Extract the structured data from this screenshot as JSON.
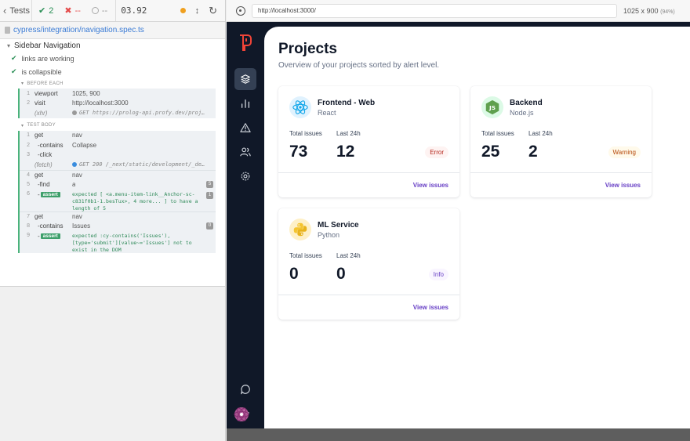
{
  "runner": {
    "back_label": "Tests",
    "passed": "2",
    "failed": "--",
    "pending": "--",
    "duration": "03.92",
    "spec_file": "cypress/integration/navigation.spec.ts",
    "suite_title": "Sidebar Navigation",
    "tests": [
      {
        "title": "links are working"
      },
      {
        "title": "is collapsible"
      }
    ],
    "before_each_label": "BEFORE EACH",
    "test_body_label": "TEST BODY",
    "before_each": [
      {
        "num": "1",
        "name": "viewport",
        "msg": "1025, 900"
      },
      {
        "num": "2",
        "name": "visit",
        "msg": "http://localhost:3000"
      },
      {
        "num": "",
        "name": "(xhr)",
        "msg": "GET https://prolog-api.profy.dev/proj…"
      }
    ],
    "body": [
      {
        "num": "1",
        "name": "get",
        "msg": "nav"
      },
      {
        "num": "2",
        "name": "-contains",
        "msg": "Collapse"
      },
      {
        "num": "3",
        "name": "-click",
        "msg": ""
      },
      {
        "num": "",
        "name": "(fetch)",
        "msg": "GET 200 /_next/static/development/_de…"
      },
      {
        "num": "4",
        "name": "get",
        "msg": "nav"
      },
      {
        "num": "5",
        "name": "-find",
        "msg": "a",
        "count": "5"
      },
      {
        "num": "6",
        "name": "-assert",
        "msg": "expected [ <a.menu-item-link__Anchor-sc-c831f0b1-1.besTux>, 4 more... ] to have a length of 5",
        "count": "1"
      },
      {
        "num": "7",
        "name": "get",
        "msg": "nav"
      },
      {
        "num": "8",
        "name": "-contains",
        "msg": "Issues",
        "count": "0"
      },
      {
        "num": "9",
        "name": "-assert",
        "msg": "expected :cy-contains('Issues'), [type='submit'][value~='Issues'] not to exist in the DOM"
      }
    ]
  },
  "preview": {
    "url": "http://localhost:3000/",
    "viewport": "1025 x 900",
    "zoom": "(94%)"
  },
  "app": {
    "title": "Projects",
    "subtitle": "Overview of your projects sorted by alert level.",
    "total_label": "Total issues",
    "last_label": "Last 24h",
    "view_label": "View issues",
    "projects": [
      {
        "name": "Frontend - Web",
        "lang": "React",
        "total": "73",
        "last24h": "12",
        "level": "Error",
        "icon": "react-icon"
      },
      {
        "name": "Backend",
        "lang": "Node.js",
        "total": "25",
        "last24h": "2",
        "level": "Warning",
        "icon": "nodejs-icon"
      },
      {
        "name": "ML Service",
        "lang": "Python",
        "total": "0",
        "last24h": "0",
        "level": "Info",
        "icon": "python-icon"
      }
    ],
    "colors": {
      "sidebar": "#101828",
      "error_bg": "#fef3f2",
      "error_text": "#b42318",
      "warning_bg": "#fffaeb",
      "warning_text": "#b54708",
      "info_bg": "#f9f5ff",
      "info_text": "#6941c6",
      "accent": "#6941c6"
    }
  }
}
